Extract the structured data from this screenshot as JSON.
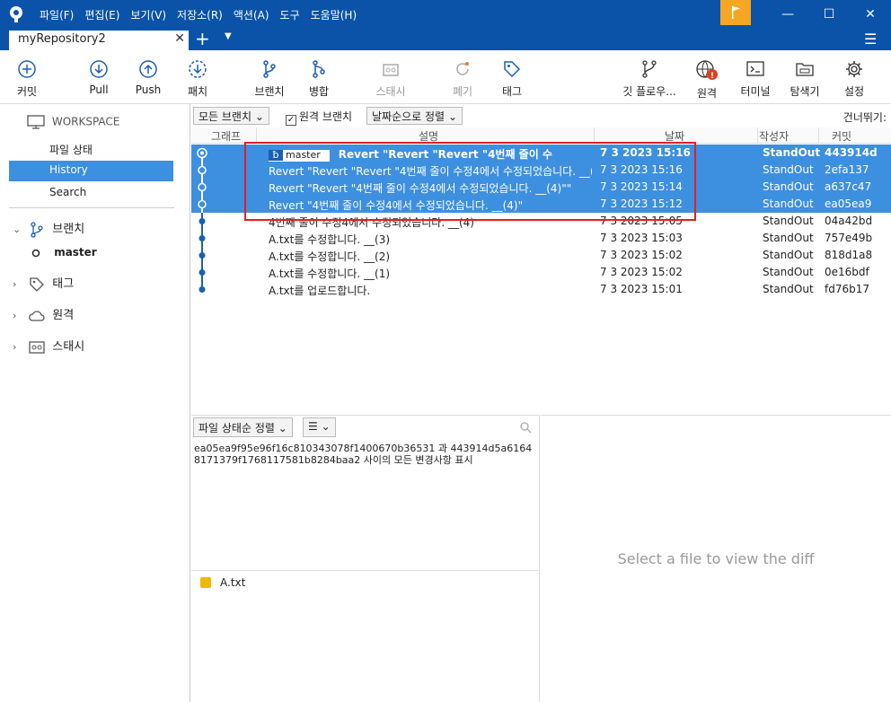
{
  "menu": [
    "파일(F)",
    "편집(E)",
    "보기(V)",
    "저장소(R)",
    "액션(A)",
    "도구",
    "도움말(H)"
  ],
  "window": {
    "minimize": "—",
    "maximize": "☐",
    "close": "✕"
  },
  "tab": {
    "title": "myRepository2",
    "close": "✕",
    "plus": "+",
    "menu": "▼",
    "hamburger": "☰"
  },
  "toolbar": {
    "commit": "커밋",
    "pull": "Pull",
    "push": "Push",
    "fetch": "패치",
    "branch": "브랜치",
    "merge": "병합",
    "stash": "스태시",
    "discard": "폐기",
    "tag": "태그",
    "gitflow": "깃 플로우...",
    "remote": "원격",
    "terminal": "터미널",
    "explorer": "탐색기",
    "settings": "설정"
  },
  "sidebar": {
    "workspace": "WORKSPACE",
    "items": [
      "파일 상태",
      "History",
      "Search"
    ],
    "branches": "브랜치",
    "branch_master": "master",
    "tags": "태그",
    "remotes": "원격",
    "stashes": "스태시"
  },
  "filter": {
    "all_branches": "모든 브랜치",
    "remote_branches": "원격 브랜치",
    "sort": "날짜순으로 정렬",
    "skip": "건너뛰기:"
  },
  "columns": {
    "graph": "그래프",
    "description": "설명",
    "date": "날짜",
    "author": "작성자",
    "commit": "커밋"
  },
  "commits": [
    {
      "branch": "master",
      "desc": "Revert \"Revert \"Revert \"4번째 줄이 수",
      "date": "7 3 2023 15:16",
      "author": "StandOut",
      "hash": "443914d"
    },
    {
      "desc": "Revert \"Revert \"Revert \"4번째 줄이 수정4에서 수정되었습니다. __(",
      "date": "7 3 2023 15:16",
      "author": "StandOut",
      "hash": "2efa137"
    },
    {
      "desc": "Revert \"Revert \"4번째 줄이 수정4에서 수정되었습니다. __(4)\"\"",
      "date": "7 3 2023 15:14",
      "author": "StandOut",
      "hash": "a637c47"
    },
    {
      "desc": "Revert \"4번째 줄이 수정4에서 수정되었습니다. __(4)\"",
      "date": "7 3 2023 15:12",
      "author": "StandOut",
      "hash": "ea05ea9"
    },
    {
      "desc": "4번째 줄이 수정4에서 수정되었습니다. __(4)",
      "date": "7 3 2023 15:05",
      "author": "StandOut",
      "hash": "04a42bd"
    },
    {
      "desc": "A.txt를 수정합니다. __(3)",
      "date": "7 3 2023 15:03",
      "author": "StandOut",
      "hash": "757e49b"
    },
    {
      "desc": "A.txt를 수정합니다. __(2)",
      "date": "7 3 2023 15:02",
      "author": "StandOut",
      "hash": "818d1a8"
    },
    {
      "desc": "A.txt를 수정합니다. __(1)",
      "date": "7 3 2023 15:02",
      "author": "StandOut",
      "hash": "0e16bdf"
    },
    {
      "desc": "A.txt를 업로드합니다.",
      "date": "7 3 2023 15:01",
      "author": "StandOut",
      "hash": "fd76b17"
    }
  ],
  "bottom": {
    "file_sort": "파일 상태순 정렬",
    "view_mode": "☰",
    "info": "ea05ea9f95e96f16c810343078f1400670b36531 과 443914d5a61648171379f1768117581b8284baa2 사이의 모든 변경사항 표시",
    "file": "A.txt",
    "diff_placeholder": "Select a file to view the diff"
  },
  "colors": {
    "accent": "#0a53a8",
    "selection": "#3d8fe0",
    "highlight_box": "#e02020"
  }
}
